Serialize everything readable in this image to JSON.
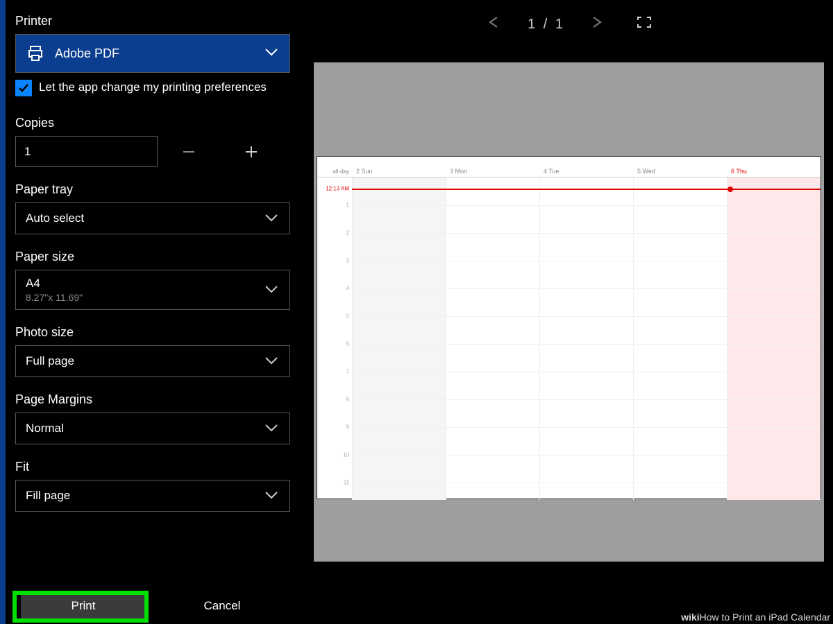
{
  "panel": {
    "printer_label": "Printer",
    "printer_value": "Adobe PDF",
    "pref_checkbox": "Let the app change my printing preferences",
    "copies_label": "Copies",
    "copies_value": "1",
    "paper_tray_label": "Paper tray",
    "paper_tray_value": "Auto select",
    "paper_size_label": "Paper size",
    "paper_size_value": "A4",
    "paper_size_sub": "8.27\"x 11.69\"",
    "photo_size_label": "Photo size",
    "photo_size_value": "Full page",
    "page_margins_label": "Page Margins",
    "page_margins_value": "Normal",
    "fit_label": "Fit",
    "fit_value": "Fill page",
    "print_btn": "Print",
    "cancel_btn": "Cancel"
  },
  "preview": {
    "page_current": "1",
    "page_sep": "/",
    "page_total": "1"
  },
  "calendar": {
    "allday_label": "all-day",
    "now_label": "12:13 AM",
    "days": [
      "2 Sun",
      "3 Mon",
      "4 Tue",
      "5 Wed",
      "6 Thu"
    ],
    "hours": [
      "1",
      "2",
      "3",
      "4",
      "5",
      "6",
      "7",
      "8",
      "9",
      "10",
      "11"
    ]
  },
  "watermark": {
    "brand_bold": "wiki",
    "brand_rest": "How",
    "tail": " to Print an iPad Calendar"
  }
}
